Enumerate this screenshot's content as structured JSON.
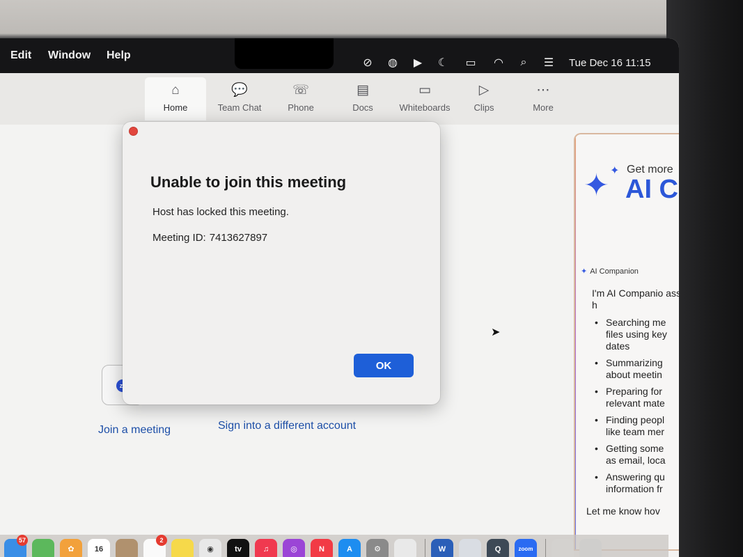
{
  "menubar": {
    "menus": [
      "Edit",
      "Window",
      "Help"
    ],
    "status_icons": [
      "screen-share-off-icon",
      "notification-app-icon",
      "play-icon",
      "moon-icon",
      "battery-icon",
      "wifi-icon",
      "search-icon",
      "control-center-icon"
    ],
    "clock": "Tue Dec 16  11:15"
  },
  "toolbar": {
    "tabs": [
      {
        "label": "Home",
        "icon": "home-icon",
        "glyph": "⌂"
      },
      {
        "label": "Team Chat",
        "icon": "chat-icon",
        "glyph": "💬"
      },
      {
        "label": "Phone",
        "icon": "phone-icon",
        "glyph": "☏"
      },
      {
        "label": "Docs",
        "icon": "docs-icon",
        "glyph": "▤"
      },
      {
        "label": "Whiteboards",
        "icon": "whiteboard-icon",
        "glyph": "▭"
      },
      {
        "label": "Clips",
        "icon": "clips-icon",
        "glyph": "▷"
      },
      {
        "label": "More",
        "icon": "more-icon",
        "glyph": "⋯"
      }
    ]
  },
  "home": {
    "zoom_badge": "zm",
    "join_link": "Join a meeting",
    "signin_link": "Sign into a different account"
  },
  "ai_panel": {
    "get_more": "Get more",
    "brand": "AI C",
    "label": "AI Companion",
    "intro": "I'm AI Companio assistant. I can h",
    "items": [
      {
        "line1": "Searching me",
        "line2": "files using key",
        "line3": "dates"
      },
      {
        "line1": "Summarizing",
        "line2": "about meetin",
        "line3": ""
      },
      {
        "line1": "Preparing for",
        "line2": "relevant mate",
        "line3": ""
      },
      {
        "line1": "Finding peopl",
        "line2": "like team mer",
        "line3": ""
      },
      {
        "line1": "Getting some",
        "line2": "as email, loca",
        "line3": ""
      },
      {
        "line1": "Answering qu",
        "line2": "information fr",
        "line3": ""
      }
    ],
    "footer": "Let me know hov"
  },
  "dialog": {
    "title": "Unable to join this meeting",
    "message": "Host has locked this meeting.",
    "meeting_id_label": "Meeting ID:",
    "meeting_id_value": "7413627897",
    "ok_label": "OK"
  },
  "dock": {
    "apps": [
      {
        "name": "mail",
        "badge": "57",
        "color": "#3a8ee6",
        "text": ""
      },
      {
        "name": "maps",
        "badge": "",
        "color": "#5cb85c",
        "text": ""
      },
      {
        "name": "photos",
        "badge": "",
        "color": "#f2a13b",
        "text": "✿"
      },
      {
        "name": "calendar",
        "badge": "",
        "color": "#ffffff",
        "text": "16"
      },
      {
        "name": "contacts",
        "badge": "",
        "color": "#b0916e",
        "text": ""
      },
      {
        "name": "reminders",
        "badge": "2",
        "color": "#fafafa",
        "text": ""
      },
      {
        "name": "notes",
        "badge": "",
        "color": "#f6d94a",
        "text": ""
      },
      {
        "name": "chrome",
        "badge": "",
        "color": "#e8e8e8",
        "text": "◉"
      },
      {
        "name": "apple-tv",
        "badge": "",
        "color": "#111111",
        "text": "tv"
      },
      {
        "name": "music",
        "badge": "",
        "color": "#f0394f",
        "text": "♫"
      },
      {
        "name": "podcasts",
        "badge": "",
        "color": "#9b45d6",
        "text": "◎"
      },
      {
        "name": "news",
        "badge": "",
        "color": "#f23b45",
        "text": "N"
      },
      {
        "name": "app-store",
        "badge": "",
        "color": "#1d8df0",
        "text": "A"
      },
      {
        "name": "system-settings",
        "badge": "",
        "color": "#8a8a8a",
        "text": "⚙"
      },
      {
        "name": "iphone-mirroring",
        "badge": "",
        "color": "#e9e9e9",
        "text": ""
      },
      {
        "name": "word",
        "badge": "",
        "color": "#2b5fb8",
        "text": "W"
      },
      {
        "name": "preview",
        "badge": "",
        "color": "#d9dde3",
        "text": ""
      },
      {
        "name": "quicktime",
        "badge": "",
        "color": "#3d4956",
        "text": "Q"
      },
      {
        "name": "zoom",
        "badge": "",
        "color": "#2a6bf2",
        "text": "zoom"
      },
      {
        "name": "downloads",
        "badge": "",
        "color": "#d4d2cf",
        "text": ""
      },
      {
        "name": "trash",
        "badge": "",
        "color": "#cfcecc",
        "text": ""
      }
    ]
  }
}
